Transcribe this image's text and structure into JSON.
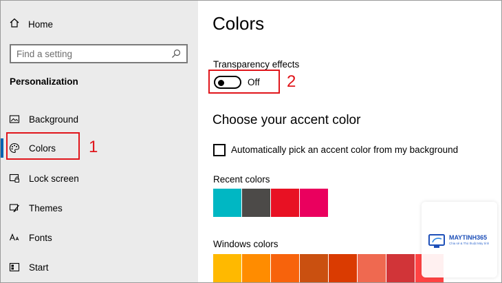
{
  "sidebar": {
    "home_label": "Home",
    "search_placeholder": "Find a setting",
    "section_title": "Personalization",
    "items": [
      {
        "label": "Background",
        "icon": "picture-icon"
      },
      {
        "label": "Colors",
        "icon": "palette-icon"
      },
      {
        "label": "Lock screen",
        "icon": "lock-screen-icon"
      },
      {
        "label": "Themes",
        "icon": "brush-icon"
      },
      {
        "label": "Fonts",
        "icon": "font-icon"
      },
      {
        "label": "Start",
        "icon": "start-icon"
      }
    ],
    "active_item": "Colors"
  },
  "main": {
    "title": "Colors",
    "transparency": {
      "label": "Transparency effects",
      "state": "Off"
    },
    "accent_heading": "Choose your accent color",
    "auto_pick": {
      "label": "Automatically pick an accent color from my background",
      "checked": false
    },
    "recent_colors": {
      "label": "Recent colors",
      "swatches": [
        "#00b7c3",
        "#4c4a48",
        "#e81123",
        "#ea005e"
      ]
    },
    "windows_colors": {
      "label": "Windows colors",
      "swatches": [
        "#ffb900",
        "#ff8c00",
        "#f7630c",
        "#ca5010",
        "#da3b01",
        "#ef6950",
        "#d13438",
        "#ff4343"
      ]
    }
  },
  "annotations": {
    "first": "1",
    "second": "2"
  },
  "watermark": {
    "brand": "MAYTINH365",
    "tagline": "Chia sẻ & Thủ thuật Máy tính"
  },
  "colors": {
    "sidebar_bg": "#ebebeb",
    "accent": "#0063b1",
    "annotation": "#e0141a"
  }
}
